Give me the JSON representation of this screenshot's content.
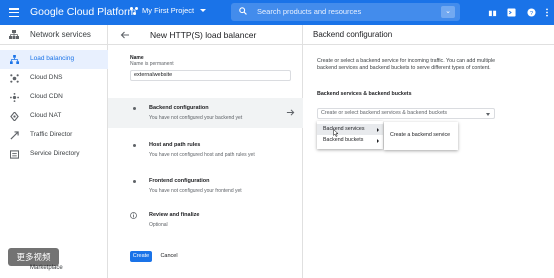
{
  "header": {
    "brand": "Google Cloud Platform",
    "project": "My First Project",
    "search_placeholder": "Search products and resources"
  },
  "nav": {
    "title": "Network services",
    "items": [
      {
        "label": "Load balancing",
        "icon": "load-balancing-icon",
        "active": true
      },
      {
        "label": "Cloud DNS",
        "icon": "dns-icon"
      },
      {
        "label": "Cloud CDN",
        "icon": "cdn-icon"
      },
      {
        "label": "Cloud NAT",
        "icon": "nat-icon"
      },
      {
        "label": "Traffic Director",
        "icon": "traffic-director-icon"
      },
      {
        "label": "Service Directory",
        "icon": "service-directory-icon"
      }
    ],
    "bottom_label": "Marketplace"
  },
  "form": {
    "title": "New HTTP(S) load balancer",
    "name_label": "Name",
    "name_hint": "Name is permanent",
    "name_value": "externalwebsite",
    "sections": [
      {
        "title": "Backend configuration",
        "subtitle": "You have not configured your backend yet"
      },
      {
        "title": "Host and path rules",
        "subtitle": "You have not configured host and path rules yet"
      },
      {
        "title": "Frontend configuration",
        "subtitle": "You have not configured your frontend yet"
      },
      {
        "title": "Review and finalize",
        "subtitle": "Optional"
      }
    ],
    "create_label": "Create",
    "cancel_label": "Cancel"
  },
  "backend_panel": {
    "title": "Backend configuration",
    "description": "Create or select a backend service for incoming traffic. You can add multiple backend services and backend buckets to serve different types of content.",
    "sub_label": "Backend services & backend buckets",
    "select_placeholder": "Create or select backend services & backend buckets",
    "menu": [
      "Backend services",
      "Backend buckets"
    ],
    "submenu": [
      "Create a backend service"
    ]
  },
  "overlay": {
    "watermark": "更多视频"
  },
  "colors": {
    "accent": "#1a73e8",
    "selected_bg": "#e8f0fe"
  }
}
